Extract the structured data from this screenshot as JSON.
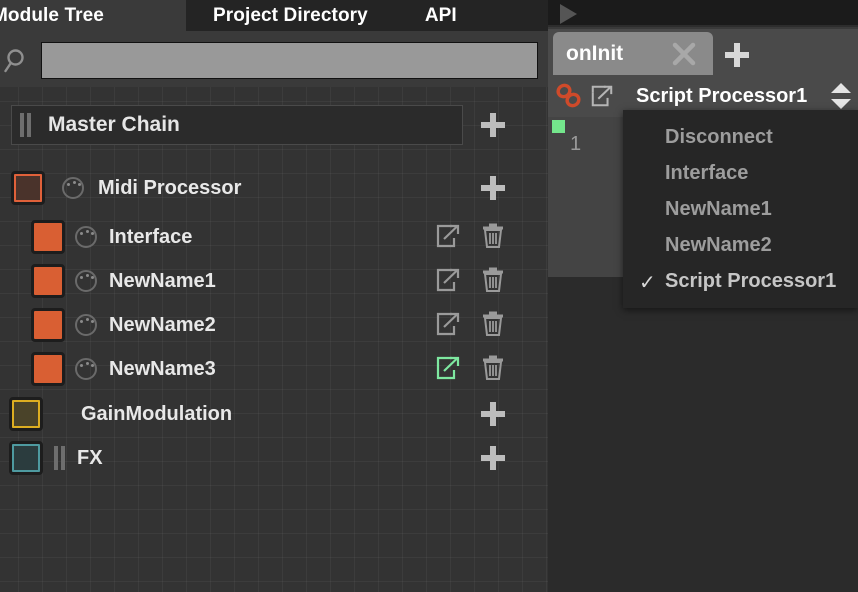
{
  "left_panel": {
    "tabs": [
      {
        "label": "Module Tree",
        "selected": false,
        "name": "tab-module-tree"
      },
      {
        "label": "Project Directory",
        "selected": true,
        "name": "tab-project-directory"
      },
      {
        "label": "API",
        "selected": false,
        "name": "tab-api"
      }
    ],
    "search": {
      "icon": "search-icon",
      "value": "",
      "placeholder": ""
    },
    "tree": {
      "master": {
        "label": "Master Chain",
        "handle_icon": "drag-handle-icon",
        "add_icon": "plus-icon"
      },
      "items": [
        {
          "label": "Midi Processor",
          "level": 0,
          "swatch_color": "#4a332b",
          "swatch_border": "#e0613a",
          "knob_icon": "knob-icon",
          "action": "add",
          "action_icon": "plus-icon",
          "name": "tree-item-midi-processor"
        },
        {
          "label": "Interface",
          "level": 1,
          "swatch_color": "#d95f33",
          "swatch_border": "#d95f33",
          "knob_icon": "knob-icon",
          "action": "edit-delete",
          "ext_icon": "external-link-icon",
          "trash_icon": "trash-icon",
          "ext_highlight": false,
          "name": "tree-item-interface"
        },
        {
          "label": "NewName1",
          "level": 1,
          "swatch_color": "#d95f33",
          "swatch_border": "#d95f33",
          "knob_icon": "knob-icon",
          "action": "edit-delete",
          "ext_icon": "external-link-icon",
          "trash_icon": "trash-icon",
          "ext_highlight": false,
          "name": "tree-item-newname1"
        },
        {
          "label": "NewName2",
          "level": 1,
          "swatch_color": "#d95f33",
          "swatch_border": "#d95f33",
          "knob_icon": "knob-icon",
          "action": "edit-delete",
          "ext_icon": "external-link-icon",
          "trash_icon": "trash-icon",
          "ext_highlight": false,
          "name": "tree-item-newname2"
        },
        {
          "label": "NewName3",
          "level": 1,
          "swatch_color": "#d95f33",
          "swatch_border": "#d95f33",
          "knob_icon": "knob-icon",
          "action": "edit-delete",
          "ext_icon": "external-link-icon",
          "trash_icon": "trash-icon",
          "ext_highlight": true,
          "ext_highlight_color": "#7ee8a0",
          "name": "tree-item-newname3"
        },
        {
          "label": "GainModulation",
          "level": 0,
          "swatch_color": "#4a4329",
          "swatch_border": "#ddae21",
          "knob_icon": null,
          "action": "add",
          "action_icon": "plus-icon",
          "name": "tree-item-gainmodulation"
        },
        {
          "label": "FX",
          "level": 0,
          "swatch_color": "#2b3c3e",
          "swatch_border": "#4e9aa0",
          "knob_icon": null,
          "handle_icon": "drag-handle-icon",
          "action": "add",
          "action_icon": "plus-icon",
          "name": "tree-item-fx"
        }
      ]
    }
  },
  "right_panel": {
    "play_icon": "play-icon",
    "tab": {
      "label": "onInit",
      "close_icon": "close-icon",
      "add_icon": "plus-icon"
    },
    "processor_bar": {
      "chain_icon": "chain-link-icon",
      "chain_icon_color": "#cf4a2a",
      "external_icon": "external-link-icon",
      "name": "Script Processor1",
      "stepper_icon": "up-down-arrows-icon"
    },
    "editor": {
      "line_number": "1",
      "breakpoint_marker_color": "#74e68c"
    }
  },
  "dropdown": {
    "items": [
      {
        "label": "Disconnect",
        "checked": false,
        "name": "menu-item-disconnect"
      },
      {
        "label": "Interface",
        "checked": false,
        "name": "menu-item-interface"
      },
      {
        "label": "NewName1",
        "checked": false,
        "name": "menu-item-newname1"
      },
      {
        "label": "NewName2",
        "checked": false,
        "name": "menu-item-newname2"
      },
      {
        "label": "Script Processor1",
        "checked": true,
        "name": "menu-item-script-processor1"
      }
    ],
    "check_glyph": "✓"
  }
}
